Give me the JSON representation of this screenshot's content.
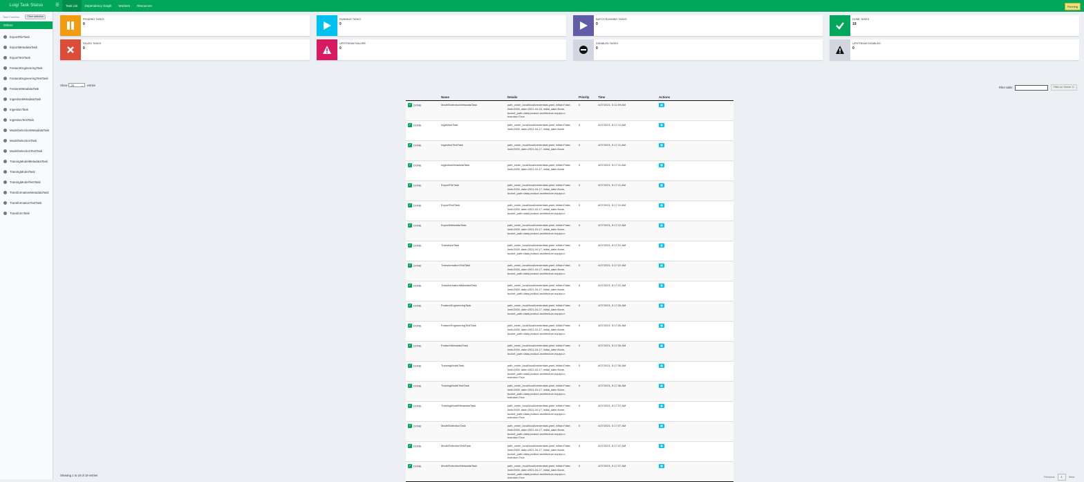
{
  "header": {
    "brand": "Luigi Task Status",
    "menu_icon": "hamburger-icon",
    "nav": [
      "Task List",
      "Dependency Graph",
      "Workers",
      "Resources"
    ],
    "running_badge": "Running"
  },
  "sidebar": {
    "label": "Task Families",
    "clear_button": "Clear selection",
    "section": "Others",
    "items": [
      {
        "label": "ExportFileTask"
      },
      {
        "label": "ExportMetadataTask"
      },
      {
        "label": "ExportTestTask"
      },
      {
        "label": "FeatureEngineeringTask"
      },
      {
        "label": "FeatureEngineeringTestTask"
      },
      {
        "label": "FeatureMetadataTask"
      },
      {
        "label": "IngestionMetadataTask"
      },
      {
        "label": "IngestionTask"
      },
      {
        "label": "IngestionTestTask"
      },
      {
        "label": "ModelSelectionMetadataTask"
      },
      {
        "label": "ModelSelectionTask"
      },
      {
        "label": "ModelSelectionTestTask"
      },
      {
        "label": "TrainingModelMetadataTask"
      },
      {
        "label": "TrainingModelTask"
      },
      {
        "label": "TrainingModelTestTask"
      },
      {
        "label": "TransformationMetadataTask"
      },
      {
        "label": "TransformationTestTask"
      },
      {
        "label": "TransformTask"
      }
    ]
  },
  "status_boxes": [
    {
      "label": "PENDING TASKS",
      "count": "0",
      "color": "#f39c12",
      "icon": "pause-icon"
    },
    {
      "label": "RUNNING TASKS",
      "count": "0",
      "color": "#00c0ef",
      "icon": "play-icon"
    },
    {
      "label": "BATCH RUNNING TASKS",
      "count": "0",
      "color": "#605ca8",
      "icon": "play-icon"
    },
    {
      "label": "DONE TASKS",
      "count": "19",
      "color": "#00a65a",
      "icon": "check-icon"
    },
    {
      "label": "FAILED TASKS",
      "count": "0",
      "color": "#dd4b39",
      "icon": "x-icon"
    },
    {
      "label": "UPSTREAM FAILURE",
      "count": "0",
      "color": "#d81b60",
      "icon": "warning-icon"
    },
    {
      "label": "DISABLED TASKS",
      "count": "0",
      "color": "#d2d6de",
      "icon": "minus-circle-icon"
    },
    {
      "label": "UPSTREAM DISABLED",
      "count": "0",
      "color": "#d2d6de",
      "icon": "warning-icon"
    }
  ],
  "table_controls": {
    "show_label": "Show",
    "entries_value": "25",
    "entries_label": "entries",
    "filter_label": "Filter table:",
    "filter_value": "",
    "filter_server": "Filter on Server"
  },
  "table": {
    "columns": [
      "",
      "Name",
      "Details",
      "Priority",
      "Time",
      "Actions"
    ],
    "rows": [
      {
        "status": "DONE",
        "name": "ModelSelectionMetadataTask",
        "details": "path_credn_local/local/credentials.yaml, initial=False, limit=2000, date=2021-04-16, initial_date=None, bucket_path=data-product-architecture-equipo-n, exercise=True",
        "priority": "0",
        "time": "4/27/2021, 5:11:59 AM"
      },
      {
        "status": "DONE",
        "name": "IngestionTask",
        "details": "path_credn_local/local/credentials.yaml, initial=False, limit=2000, date=2021-04-17, initial_date=None",
        "priority": "0",
        "time": "4/27/2021, 5:17:11 AM"
      },
      {
        "status": "DONE",
        "name": "IngestionTestTask",
        "details": "path_credn_local/local/credentials.yaml, initial=False, limit=2000, date=2021-04-17, initial_date=None",
        "priority": "0",
        "time": "4/27/2021, 5:17:11 AM"
      },
      {
        "status": "DONE",
        "name": "IngestionMetadataTask",
        "details": "path_credn_local/local/credentials.yaml, initial=False, limit=2000, date=2021-04-17, initial_date=None",
        "priority": "0",
        "time": "4/27/2021, 5:17:11 AM"
      },
      {
        "status": "DONE",
        "name": "ExportFileTask",
        "details": "path_credn_local/local/credentials.yaml, initial=False, limit=2000, date=2021-04-17, initial_date=None, bucket_path=data-product-architecture-equipo-n",
        "priority": "0",
        "time": "4/27/2021, 5:17:11 AM"
      },
      {
        "status": "DONE",
        "name": "ExportTestTask",
        "details": "path_credn_local/local/credentials.yaml, initial=False, limit=2000, date=2021-04-17, initial_date=None, bucket_path=data-product-architecture-equipo-n",
        "priority": "0",
        "time": "4/27/2021, 5:17:11 AM"
      },
      {
        "status": "DONE",
        "name": "ExportMetadataTask",
        "details": "path_credn_local/local/credentials.yaml, initial=False, limit=2000, date=2021-04-17, initial_date=None, bucket_path=data-product-architecture-equipo-n",
        "priority": "0",
        "time": "4/27/2021, 5:17:12 AM"
      },
      {
        "status": "DONE",
        "name": "TransformTask",
        "details": "path_credn_local/local/credentials.yaml, initial=False, limit=2000, date=2021-04-17, initial_date=None, bucket_path=data-product-architecture-equipo-n",
        "priority": "0",
        "time": "4/27/2021, 5:17:22 AM"
      },
      {
        "status": "DONE",
        "name": "TransformationTestTask",
        "details": "path_credn_local/local/credentials.yaml, initial=False, limit=2000, date=2021-04-17, initial_date=None, bucket_path=data-product-architecture-equipo-n",
        "priority": "0",
        "time": "4/27/2021, 5:17:22 AM"
      },
      {
        "status": "DONE",
        "name": "TransformationMetadataTask",
        "details": "path_credn_local/local/credentials.yaml, initial=False, limit=2000, date=2021-04-17, initial_date=None, bucket_path=data-product-architecture-equipo-n",
        "priority": "0",
        "time": "4/27/2021, 5:17:22 AM"
      },
      {
        "status": "DONE",
        "name": "FeatureEngineeringTask",
        "details": "path_credn_local/local/credentials.yaml, initial=False, limit=2000, date=2021-04-17, initial_date=None, bucket_path=data-product-architecture-equipo-n",
        "priority": "0",
        "time": "4/27/2021, 5:17:26 AM"
      },
      {
        "status": "DONE",
        "name": "FeatureEngineeringTestTask",
        "details": "path_credn_local/local/credentials.yaml, initial=False, limit=2000, date=2021-04-17, initial_date=None, bucket_path=data-product-architecture-equipo-n",
        "priority": "0",
        "time": "4/27/2021, 5:17:26 AM"
      },
      {
        "status": "DONE",
        "name": "FeatureMetadataTask",
        "details": "path_credn_local/local/credentials.yaml, initial=False, limit=2000, date=2021-04-17, initial_date=None, bucket_path=data-product-architecture-equipo-n",
        "priority": "0",
        "time": "4/27/2021, 5:17:26 AM"
      },
      {
        "status": "DONE",
        "name": "TrainingModelTask",
        "details": "path_credn_local/local/credentials.yaml, initial=False, limit=2000, date=2021-04-17, initial_date=None, bucket_path=data-product-architecture-equipo-n, exercise=True",
        "priority": "0",
        "time": "4/27/2021, 5:17:36 AM"
      },
      {
        "status": "DONE",
        "name": "TrainingModelTestTask",
        "details": "path_credn_local/local/credentials.yaml, initial=False, limit=2000, date=2021-04-17, initial_date=None, bucket_path=data-product-architecture-equipo-n, exercise=True",
        "priority": "0",
        "time": "4/27/2021, 5:17:36 AM"
      },
      {
        "status": "DONE",
        "name": "TrainingModelMetadataTask",
        "details": "path_credn_local/local/credentials.yaml, initial=False, limit=2000, date=2021-04-17, initial_date=None, bucket_path=data-product-architecture-equipo-n, exercise=True",
        "priority": "0",
        "time": "4/27/2021, 5:17:37 AM"
      },
      {
        "status": "DONE",
        "name": "ModelSelectionTask",
        "details": "path_credn_local/local/credentials.yaml, initial=False, limit=2000, date=2021-04-17, initial_date=None, bucket_path=data-product-architecture-equipo-n, exercise=True",
        "priority": "0",
        "time": "4/27/2021, 5:17:37 AM"
      },
      {
        "status": "DONE",
        "name": "ModelSelectionTestTask",
        "details": "path_credn_local/local/credentials.yaml, initial=False, limit=2000, date=2021-04-17, initial_date=None, bucket_path=data-product-architecture-equipo-n, exercise=True",
        "priority": "0",
        "time": "4/27/2021, 5:17:37 AM"
      },
      {
        "status": "DONE",
        "name": "ModelSelectionMetadataTask",
        "details": "path_credn_local/local/credentials.yaml, initial=False, limit=2000, date=2021-04-17, initial_date=None, bucket_path=data-product-architecture-equipo-n, exercise=True",
        "priority": "0",
        "time": "4/27/2021, 5:17:37 AM"
      }
    ]
  },
  "footer": {
    "showing": "Showing 1 to 19 of 19 entries",
    "previous": "Previous",
    "page": "1",
    "next": "Next"
  }
}
